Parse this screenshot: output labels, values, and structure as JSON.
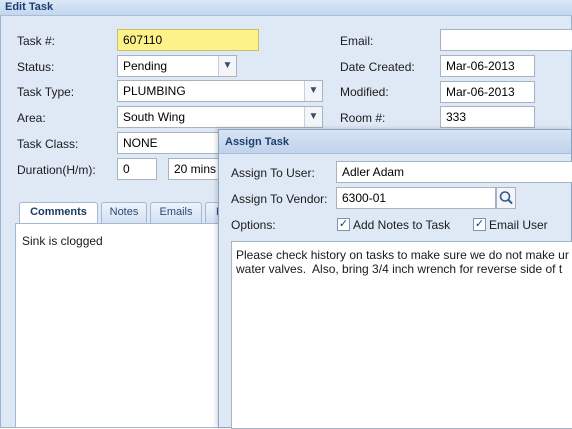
{
  "window": {
    "title": "Edit Task"
  },
  "form": {
    "task_no": {
      "label": "Task #:",
      "value": "607110"
    },
    "status": {
      "label": "Status:",
      "value": "Pending"
    },
    "task_type": {
      "label": "Task Type:",
      "value": "PLUMBING"
    },
    "area": {
      "label": "Area:",
      "value": "South Wing"
    },
    "task_class": {
      "label": "Task Class:",
      "value": "NONE"
    },
    "duration": {
      "label": "Duration(H/m):",
      "hours": "0",
      "minutes": "20 mins"
    },
    "email": {
      "label": "Email:",
      "value": ""
    },
    "date_created": {
      "label": "Date Created:",
      "value": "Mar-06-2013"
    },
    "modified": {
      "label": "Modified:",
      "value": "Mar-06-2013"
    },
    "room": {
      "label": "Room #:",
      "value": "333"
    }
  },
  "tabs": [
    {
      "label": "Comments",
      "active": true
    },
    {
      "label": "Notes"
    },
    {
      "label": "Emails"
    },
    {
      "label": "D"
    }
  ],
  "comments_text": "Sink is clogged",
  "dialog": {
    "title": "Assign Task",
    "assign_user": {
      "label": "Assign To User:",
      "value": "Adler Adam"
    },
    "assign_vendor": {
      "label": "Assign To Vendor:",
      "value": "6300-01"
    },
    "options": {
      "label": "Options:",
      "add_notes": {
        "label": "Add Notes to Task",
        "checked": true
      },
      "email_user": {
        "label": "Email User",
        "checked": true
      }
    },
    "notes_text": "Please check history on tasks to make sure we do not make ur\nwater valves.  Also, bring 3/4 inch wrench for reverse side of t"
  },
  "icons": {
    "dropdown": "chevron-down-icon",
    "search": "magnifier-icon",
    "check": "check-icon"
  }
}
